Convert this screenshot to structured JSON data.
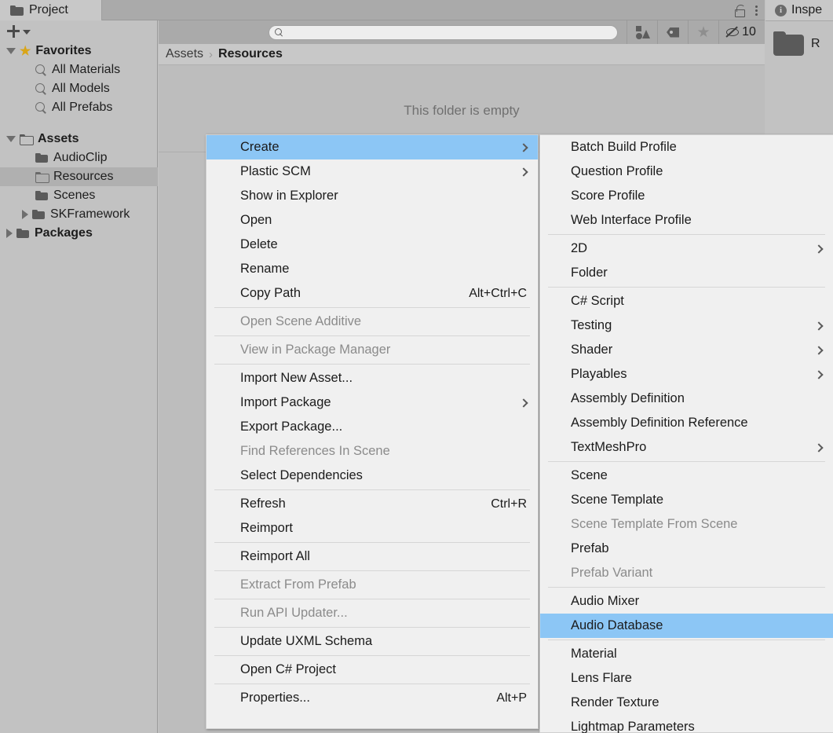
{
  "window": {
    "tab_label": "Project",
    "tab_icon": "folder-icon",
    "lock_icon": "lock-icon",
    "options_icon": "kebab-menu-icon"
  },
  "inspector": {
    "tab_label": "Inspe",
    "info_icon": "info-icon",
    "asset_icon": "folder-icon",
    "asset_name": "R"
  },
  "left_panel": {
    "add_label": "+",
    "add_icon": "plus-icon",
    "dropdown_icon": "chevron-down-icon",
    "tree": [
      {
        "label": "Favorites",
        "icon": "star-icon",
        "indent": 0,
        "twisty": "open",
        "bold": true,
        "selected": false
      },
      {
        "label": "All Materials",
        "icon": "search-icon",
        "indent": 1,
        "twisty": "none",
        "bold": false,
        "selected": false
      },
      {
        "label": "All Models",
        "icon": "search-icon",
        "indent": 1,
        "twisty": "none",
        "bold": false,
        "selected": false
      },
      {
        "label": "All Prefabs",
        "icon": "search-icon",
        "indent": 1,
        "twisty": "none",
        "bold": false,
        "selected": false
      },
      {
        "label": "",
        "icon": "none",
        "indent": 0,
        "twisty": "none",
        "bold": false,
        "selected": false
      },
      {
        "label": "Assets",
        "icon": "folder-open-icon",
        "indent": 0,
        "twisty": "open",
        "bold": true,
        "selected": false
      },
      {
        "label": "AudioClip",
        "icon": "folder-icon",
        "indent": 1,
        "twisty": "none",
        "bold": false,
        "selected": false
      },
      {
        "label": "Resources",
        "icon": "folder-outline-icon",
        "indent": 1,
        "twisty": "none",
        "bold": false,
        "selected": true
      },
      {
        "label": "Scenes",
        "icon": "folder-icon",
        "indent": 1,
        "twisty": "none",
        "bold": false,
        "selected": false
      },
      {
        "label": "SKFramework",
        "icon": "folder-icon",
        "indent": 1,
        "twisty": "closed",
        "bold": false,
        "selected": false
      },
      {
        "label": "Packages",
        "icon": "folder-icon",
        "indent": 0,
        "twisty": "closed",
        "bold": true,
        "selected": false
      }
    ]
  },
  "toolbar": {
    "search_value": "",
    "search_placeholder": "",
    "search_icon": "search-icon",
    "type_filter_icon": "asset-type-filter-icon",
    "label_filter_icon": "label-tag-icon",
    "favorite_icon": "star-icon",
    "hidden_packages_icon": "eye-off-icon",
    "hidden_packages_count": "10"
  },
  "breadcrumb": {
    "root": "Assets",
    "separator": "›",
    "current": "Resources"
  },
  "content": {
    "empty_message": "This folder is empty"
  },
  "context_menu": {
    "items": [
      {
        "label": "Create",
        "shortcut": "",
        "submenu": true,
        "disabled": false,
        "highlight": true
      },
      {
        "label": "Plastic SCM",
        "shortcut": "",
        "submenu": true,
        "disabled": false,
        "highlight": false
      },
      {
        "label": "Show in Explorer",
        "shortcut": "",
        "submenu": false,
        "disabled": false,
        "highlight": false
      },
      {
        "label": "Open",
        "shortcut": "",
        "submenu": false,
        "disabled": false,
        "highlight": false
      },
      {
        "label": "Delete",
        "shortcut": "",
        "submenu": false,
        "disabled": false,
        "highlight": false
      },
      {
        "label": "Rename",
        "shortcut": "",
        "submenu": false,
        "disabled": false,
        "highlight": false
      },
      {
        "label": "Copy Path",
        "shortcut": "Alt+Ctrl+C",
        "submenu": false,
        "disabled": false,
        "highlight": false
      },
      {
        "separator": true
      },
      {
        "label": "Open Scene Additive",
        "shortcut": "",
        "submenu": false,
        "disabled": true,
        "highlight": false
      },
      {
        "separator": true
      },
      {
        "label": "View in Package Manager",
        "shortcut": "",
        "submenu": false,
        "disabled": true,
        "highlight": false
      },
      {
        "separator": true
      },
      {
        "label": "Import New Asset...",
        "shortcut": "",
        "submenu": false,
        "disabled": false,
        "highlight": false
      },
      {
        "label": "Import Package",
        "shortcut": "",
        "submenu": true,
        "disabled": false,
        "highlight": false
      },
      {
        "label": "Export Package...",
        "shortcut": "",
        "submenu": false,
        "disabled": false,
        "highlight": false
      },
      {
        "label": "Find References In Scene",
        "shortcut": "",
        "submenu": false,
        "disabled": true,
        "highlight": false
      },
      {
        "label": "Select Dependencies",
        "shortcut": "",
        "submenu": false,
        "disabled": false,
        "highlight": false
      },
      {
        "separator": true
      },
      {
        "label": "Refresh",
        "shortcut": "Ctrl+R",
        "submenu": false,
        "disabled": false,
        "highlight": false
      },
      {
        "label": "Reimport",
        "shortcut": "",
        "submenu": false,
        "disabled": false,
        "highlight": false
      },
      {
        "separator": true
      },
      {
        "label": "Reimport All",
        "shortcut": "",
        "submenu": false,
        "disabled": false,
        "highlight": false
      },
      {
        "separator": true
      },
      {
        "label": "Extract From Prefab",
        "shortcut": "",
        "submenu": false,
        "disabled": true,
        "highlight": false
      },
      {
        "separator": true
      },
      {
        "label": "Run API Updater...",
        "shortcut": "",
        "submenu": false,
        "disabled": true,
        "highlight": false
      },
      {
        "separator": true
      },
      {
        "label": "Update UXML Schema",
        "shortcut": "",
        "submenu": false,
        "disabled": false,
        "highlight": false
      },
      {
        "separator": true
      },
      {
        "label": "Open C# Project",
        "shortcut": "",
        "submenu": false,
        "disabled": false,
        "highlight": false
      },
      {
        "separator": true
      },
      {
        "label": "Properties...",
        "shortcut": "Alt+P",
        "submenu": false,
        "disabled": false,
        "highlight": false
      }
    ]
  },
  "create_submenu": {
    "items": [
      {
        "label": "Batch Build Profile",
        "submenu": false,
        "disabled": false,
        "highlight": false
      },
      {
        "label": "Question Profile",
        "submenu": false,
        "disabled": false,
        "highlight": false
      },
      {
        "label": "Score Profile",
        "submenu": false,
        "disabled": false,
        "highlight": false
      },
      {
        "label": "Web Interface Profile",
        "submenu": false,
        "disabled": false,
        "highlight": false
      },
      {
        "separator": true
      },
      {
        "label": "2D",
        "submenu": true,
        "disabled": false,
        "highlight": false
      },
      {
        "label": "Folder",
        "submenu": false,
        "disabled": false,
        "highlight": false
      },
      {
        "separator": true
      },
      {
        "label": "C# Script",
        "submenu": false,
        "disabled": false,
        "highlight": false
      },
      {
        "label": "Testing",
        "submenu": true,
        "disabled": false,
        "highlight": false
      },
      {
        "label": "Shader",
        "submenu": true,
        "disabled": false,
        "highlight": false
      },
      {
        "label": "Playables",
        "submenu": true,
        "disabled": false,
        "highlight": false
      },
      {
        "label": "Assembly Definition",
        "submenu": false,
        "disabled": false,
        "highlight": false
      },
      {
        "label": "Assembly Definition Reference",
        "submenu": false,
        "disabled": false,
        "highlight": false
      },
      {
        "label": "TextMeshPro",
        "submenu": true,
        "disabled": false,
        "highlight": false
      },
      {
        "separator": true
      },
      {
        "label": "Scene",
        "submenu": false,
        "disabled": false,
        "highlight": false
      },
      {
        "label": "Scene Template",
        "submenu": false,
        "disabled": false,
        "highlight": false
      },
      {
        "label": "Scene Template From Scene",
        "submenu": false,
        "disabled": true,
        "highlight": false
      },
      {
        "label": "Prefab",
        "submenu": false,
        "disabled": false,
        "highlight": false
      },
      {
        "label": "Prefab Variant",
        "submenu": false,
        "disabled": true,
        "highlight": false
      },
      {
        "separator": true
      },
      {
        "label": "Audio Mixer",
        "submenu": false,
        "disabled": false,
        "highlight": false
      },
      {
        "label": "Audio Database",
        "submenu": false,
        "disabled": false,
        "highlight": true
      },
      {
        "separator": true
      },
      {
        "label": "Material",
        "submenu": false,
        "disabled": false,
        "highlight": false
      },
      {
        "label": "Lens Flare",
        "submenu": false,
        "disabled": false,
        "highlight": false
      },
      {
        "label": "Render Texture",
        "submenu": false,
        "disabled": false,
        "highlight": false
      },
      {
        "label": "Lightmap Parameters",
        "submenu": false,
        "disabled": false,
        "highlight": false
      }
    ]
  },
  "colors": {
    "highlight": "#8cc6f5",
    "menu_bg": "#f0f0f0",
    "panel_bg": "#c2c2c2",
    "toolbar_bg": "#aaaaaa",
    "selected_row": "#b0b0b0",
    "star": "#d9a518"
  }
}
